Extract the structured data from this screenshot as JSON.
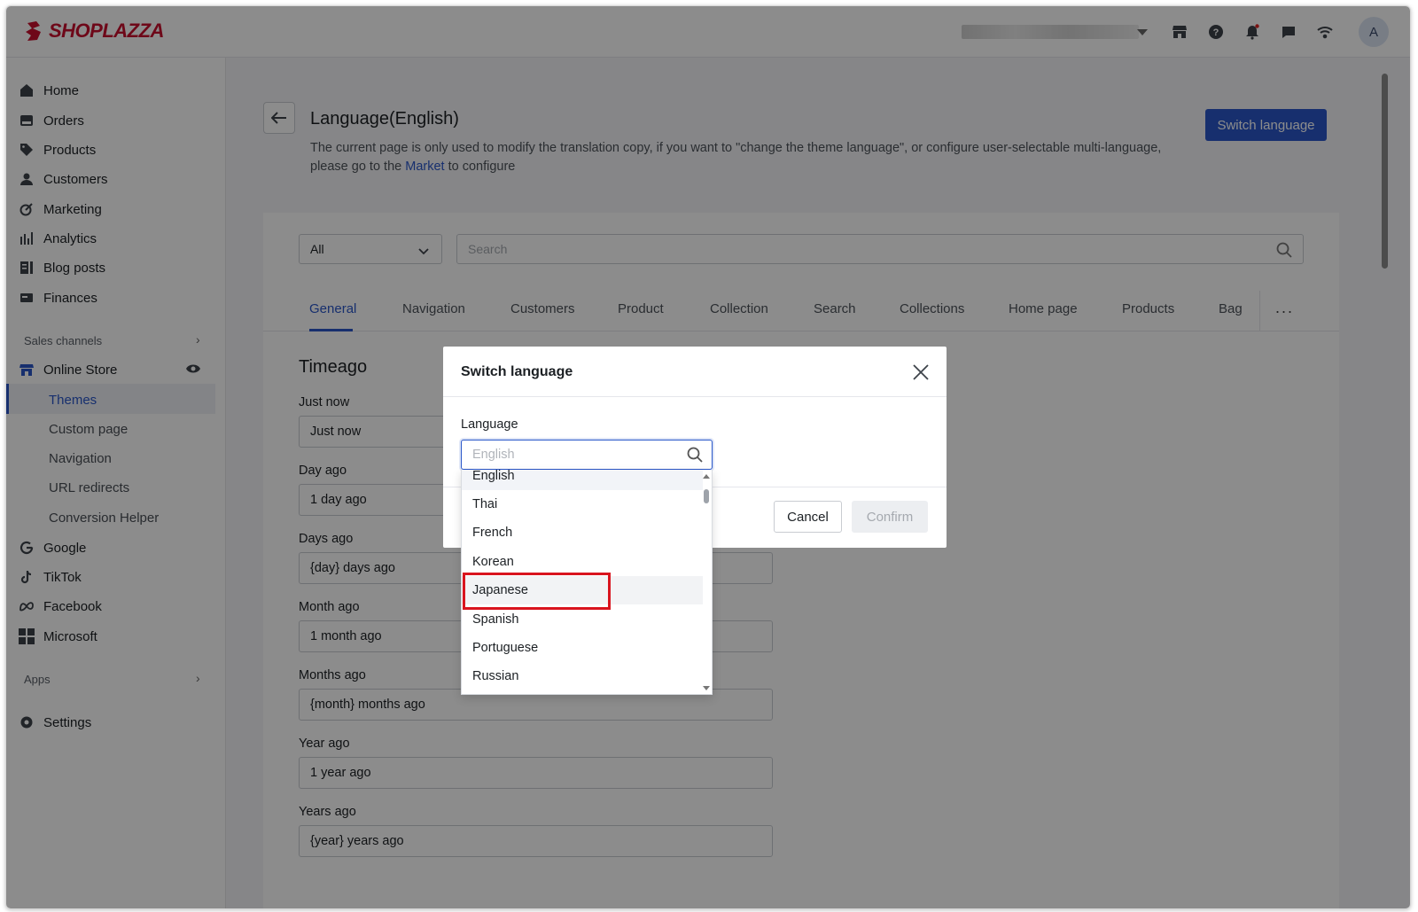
{
  "brand": {
    "name": "SHOPLAZZA",
    "color": "#c8102e"
  },
  "topbar": {
    "icons": [
      "store-icon",
      "help-icon",
      "bell-icon",
      "chat-icon",
      "wifi-icon"
    ],
    "avatar_initial": "A"
  },
  "sidebar": {
    "items": [
      {
        "label": "Home",
        "icon": "home-icon"
      },
      {
        "label": "Orders",
        "icon": "orders-icon"
      },
      {
        "label": "Products",
        "icon": "tag-icon"
      },
      {
        "label": "Customers",
        "icon": "person-icon"
      },
      {
        "label": "Marketing",
        "icon": "marketing-icon"
      },
      {
        "label": "Analytics",
        "icon": "bar-chart-icon"
      },
      {
        "label": "Blog posts",
        "icon": "blog-icon"
      },
      {
        "label": "Finances",
        "icon": "finance-icon"
      }
    ],
    "sales_channels_label": "Sales channels",
    "online_store_label": "Online Store",
    "online_store_subitems": [
      "Themes",
      "Custom page",
      "Navigation",
      "URL redirects",
      "Conversion Helper"
    ],
    "channels": [
      {
        "label": "Google",
        "icon": "google-icon"
      },
      {
        "label": "TikTok",
        "icon": "tiktok-icon"
      },
      {
        "label": "Facebook",
        "icon": "meta-icon"
      },
      {
        "label": "Microsoft",
        "icon": "microsoft-icon"
      }
    ],
    "apps_label": "Apps",
    "settings_label": "Settings"
  },
  "page": {
    "title": "Language(English)",
    "desc_part1": "The current page is only used to modify the translation copy, if you want to \"change the theme language\", or configure user-selectable multi-language, please go to the ",
    "desc_link": "Market",
    "desc_part2": " to configure",
    "switch_button": "Switch language",
    "filter_value": "All",
    "search_placeholder": "Search",
    "tabs": [
      "General",
      "Navigation",
      "Customers",
      "Product",
      "Collection",
      "Search",
      "Collections",
      "Home page",
      "Products",
      "Bag"
    ],
    "active_tab": "General",
    "section_title": "Timeago",
    "fields": [
      {
        "label": "Just now",
        "value": "Just now"
      },
      {
        "label": "Day ago",
        "value": "1 day ago"
      },
      {
        "label": "Days ago",
        "value": "{day} days ago"
      },
      {
        "label": "Month ago",
        "value": "1 month ago"
      },
      {
        "label": "Months ago",
        "value": "{month} months ago"
      },
      {
        "label": "Year ago",
        "value": "1 year ago"
      },
      {
        "label": "Years ago",
        "value": "{year} years ago"
      }
    ]
  },
  "modal": {
    "title": "Switch language",
    "language_label": "Language",
    "language_placeholder": "English",
    "options": [
      "English",
      "Thai",
      "French",
      "Korean",
      "Japanese",
      "Spanish",
      "Portuguese",
      "Russian"
    ],
    "selected": "English",
    "highlighted": "Japanese",
    "cancel": "Cancel",
    "confirm": "Confirm"
  },
  "colors": {
    "accent": "#2a57c9",
    "highlight_box": "#d9141e"
  }
}
